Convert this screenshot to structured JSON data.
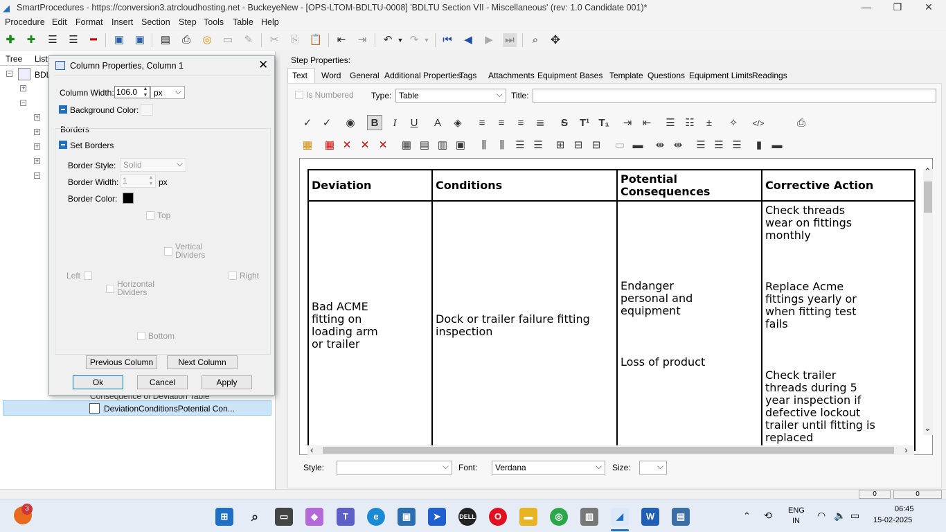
{
  "window": {
    "title": "SmartProcedures - https://conversion3.atrcloudhosting.net - BuckeyeNew - [OPS-LTOM-BDLTU-0008] 'BDLTU Section VII - Miscellaneous' (rev: 1.0 Candidate 001)*"
  },
  "menu": [
    "Procedure",
    "Edit",
    "Format",
    "Insert",
    "Section",
    "Step",
    "Tools",
    "Table",
    "Help"
  ],
  "left_panel": {
    "tabs": [
      "Tree",
      "List"
    ],
    "tree_root": "BDL",
    "tree_item_partial": "Consequence of Deviation Table",
    "tree_item_selected": "DeviationConditionsPotential Con..."
  },
  "dialog": {
    "title": "Column Properties, Column 1",
    "column_width_label": "Column Width:",
    "column_width_value": "106.0",
    "column_width_unit": "px",
    "background_color_label": "Background Color:",
    "borders_section": "Borders",
    "set_borders_label": "Set Borders",
    "border_style_label": "Border Style:",
    "border_style_value": "Solid",
    "border_width_label": "Border Width:",
    "border_width_value": "1",
    "border_width_unit": "px",
    "border_color_label": "Border Color:",
    "top_label": "Top",
    "vertical_dividers_label": "Vertical Dividers",
    "left_label": "Left",
    "horizontal_dividers_label": "Horizontal Dividers",
    "right_label": "Right",
    "bottom_label": "Bottom",
    "prev_column": "Previous Column",
    "next_column": "Next Column",
    "ok": "Ok",
    "cancel": "Cancel",
    "apply": "Apply"
  },
  "step_properties": {
    "heading": "Step Properties:",
    "tabs": [
      "Text",
      "Word",
      "General",
      "Additional Properties",
      "Tags",
      "Attachments",
      "Equipment",
      "Bases",
      "Template",
      "Questions",
      "Equipment Limits",
      "Readings"
    ],
    "is_numbered_label": "Is Numbered",
    "type_label": "Type:",
    "type_value": "Table",
    "title_label": "Title:",
    "title_value": ""
  },
  "table": {
    "headers": [
      "Deviation",
      "Conditions",
      "Potential Consequences",
      "Corrective Action"
    ],
    "deviation": "Bad ACME fitting on loading arm or trailer",
    "conditions": "Dock or trailer failure fitting inspection",
    "consequence_1": "Endanger personal and equipment",
    "consequence_2": "Loss of product",
    "action_1": "Check threads wear on fittings monthly",
    "action_2": "Replace Acme fittings yearly or when fitting test fails",
    "action_3": "Check trailer threads during 5 year inspection if defective lockout trailer until fitting is replaced"
  },
  "bottom_bar": {
    "style_label": "Style:",
    "style_value": "",
    "font_label": "Font:",
    "font_value": "Verdana",
    "size_label": "Size:",
    "size_value": "",
    "status_1": "0",
    "status_2": "0"
  },
  "taskbar": {
    "notification_count": "3",
    "lang_1": "ENG",
    "lang_2": "IN",
    "time": "06:45",
    "date": "15-02-2025"
  },
  "colors": {
    "accent": "#1f6fc5",
    "selected_row": "#cce4f7"
  }
}
